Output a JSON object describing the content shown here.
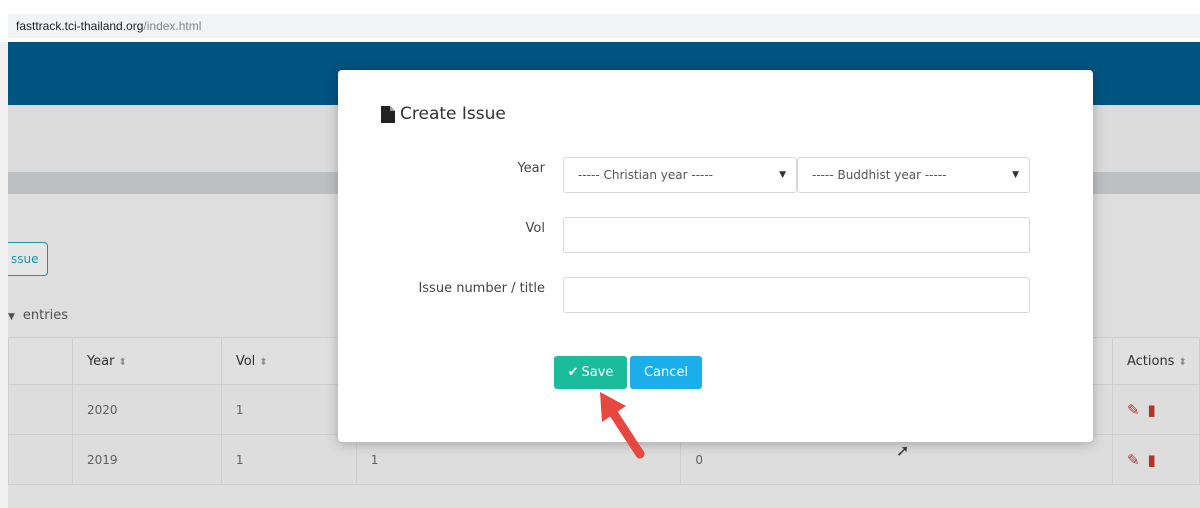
{
  "browser": {
    "url_host": "fasttrack.tci-thailand.org",
    "url_path": "/index.html"
  },
  "page": {
    "new_issue_label": "ssue",
    "entries_label": "entries",
    "table": {
      "headers": [
        "",
        "Year",
        "Vol",
        "",
        "",
        "Actions"
      ],
      "rows": [
        [
          "",
          "2020",
          "1",
          "",
          "",
          ""
        ],
        [
          "",
          "2019",
          "1",
          "1",
          "0",
          ""
        ]
      ]
    }
  },
  "modal": {
    "title": "Create Issue",
    "year_label": "Year",
    "christian_year_select": "----- Christian year -----",
    "buddhist_year_select": "----- Buddhist year -----",
    "vol_label": "Vol",
    "vol_value": "",
    "issue_label": "Issue number / title",
    "issue_value": "",
    "save_label": "Save",
    "cancel_label": "Cancel"
  },
  "colors": {
    "nav": "#005a8a",
    "save": "#1abc9c",
    "cancel": "#1aaeea",
    "arrow": "#e8473f"
  }
}
